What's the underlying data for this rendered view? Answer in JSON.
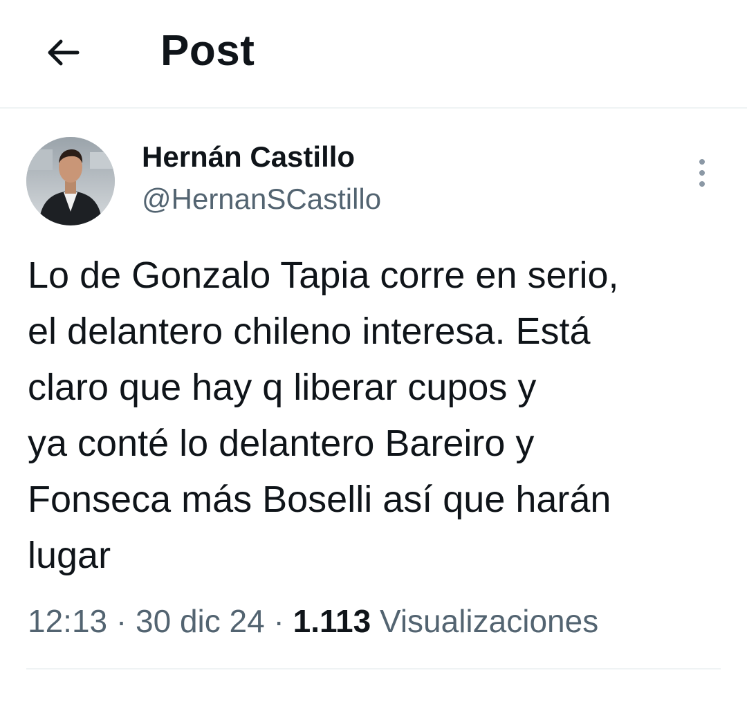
{
  "header": {
    "back_icon": "arrow-left-icon",
    "title": "Post"
  },
  "post": {
    "author": {
      "name": "Hernán Castillo",
      "handle": "@HernanSCastillo",
      "avatar_icon": "profile-photo"
    },
    "more_icon": "more-vertical-icon",
    "text_lines": [
      "Lo de Gonzalo Tapia corre en serio,",
      "el delantero chileno interesa. Está",
      "claro que hay q liberar cupos y",
      "ya conté lo delantero Bareiro y",
      "Fonseca más Boselli así que harán",
      "lugar"
    ],
    "meta": {
      "time": "12:13",
      "separator": " · ",
      "date": "30 dic 24",
      "views_count": "1.113",
      "views_label": "Visualizaciones"
    }
  }
}
